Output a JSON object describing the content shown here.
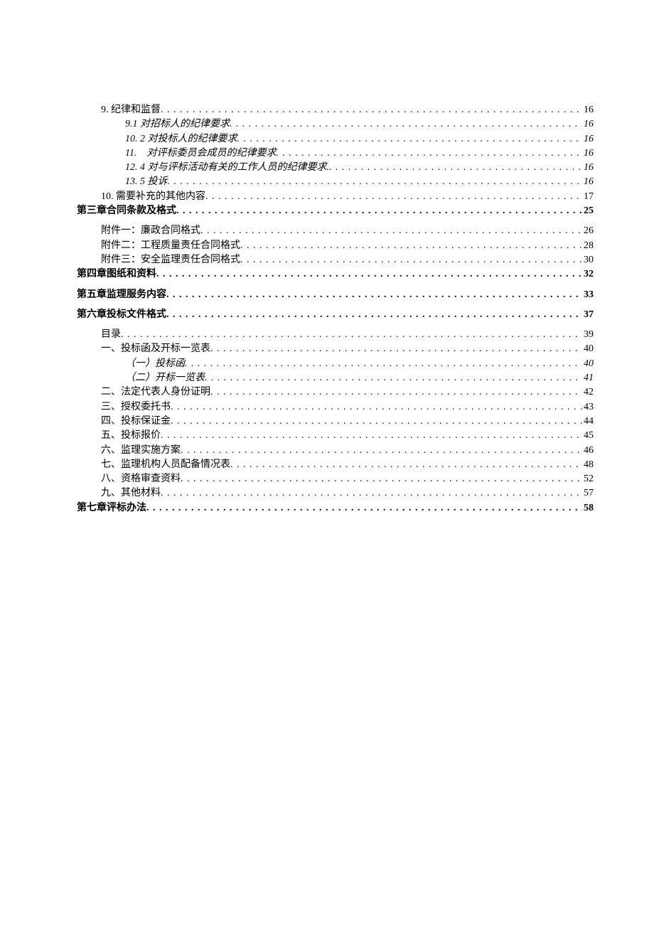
{
  "toc": [
    {
      "label": "9. 纪律和监督",
      "page": "16",
      "indent": 1,
      "italic": false,
      "bold": false,
      "gapBefore": false
    },
    {
      "label": "9.1 对招标人的纪律要求",
      "page": "16",
      "indent": 2,
      "italic": true,
      "bold": false,
      "gapBefore": false
    },
    {
      "label": "10. 2 对投标人的纪律要求",
      "page": "16",
      "indent": 2,
      "italic": true,
      "bold": false,
      "gapBefore": false
    },
    {
      "label": "11.　对评标委员会成员的纪律要求",
      "page": "16",
      "indent": 2,
      "italic": true,
      "bold": false,
      "gapBefore": false
    },
    {
      "label": "12. 4 对与评标活动有关的工作人员的纪律要求.",
      "page": "16",
      "indent": 2,
      "italic": true,
      "bold": false,
      "gapBefore": false
    },
    {
      "label": "13. 5 投诉",
      "page": "16",
      "indent": 2,
      "italic": true,
      "bold": false,
      "gapBefore": false
    },
    {
      "label": "10. 需要补充的其他内容",
      "page": "17",
      "indent": 1,
      "italic": false,
      "bold": false,
      "gapBefore": false
    },
    {
      "label": "第三章合同条款及格式",
      "page": "25",
      "indent": 0,
      "italic": false,
      "bold": true,
      "gapBefore": false
    },
    {
      "label": "附件一：廉政合同格式",
      "page": "26",
      "indent": 1,
      "italic": false,
      "bold": false,
      "gapBefore": true
    },
    {
      "label": "附件二：工程质量责任合同格式",
      "page": "28",
      "indent": 1,
      "italic": false,
      "bold": false,
      "gapBefore": false
    },
    {
      "label": "附件三：安全监理责任合同格式",
      "page": "30",
      "indent": 1,
      "italic": false,
      "bold": false,
      "gapBefore": false
    },
    {
      "label": "第四章图纸和资料",
      "page": "32",
      "indent": 0,
      "italic": false,
      "bold": true,
      "gapBefore": false
    },
    {
      "label": "第五章监理服务内容",
      "page": "33",
      "indent": 0,
      "italic": false,
      "bold": true,
      "gapBefore": true
    },
    {
      "label": "第六章投标文件格式",
      "page": "37",
      "indent": 0,
      "italic": false,
      "bold": true,
      "gapBefore": true
    },
    {
      "label": "目录",
      "page": "39",
      "indent": 1,
      "italic": false,
      "bold": false,
      "gapBefore": true
    },
    {
      "label": "一、投标函及开标一览表",
      "page": "40",
      "indent": 1,
      "italic": false,
      "bold": false,
      "gapBefore": false
    },
    {
      "label": "（一）投标函",
      "page": "40",
      "indent": 2,
      "italic": true,
      "bold": false,
      "gapBefore": false
    },
    {
      "label": "（二）开标一览表",
      "page": "41",
      "indent": 2,
      "italic": true,
      "bold": false,
      "gapBefore": false
    },
    {
      "label": "二、法定代表人身份证明",
      "page": "42",
      "indent": 1,
      "italic": false,
      "bold": false,
      "gapBefore": false
    },
    {
      "label": "三、授权委托书",
      "page": "43",
      "indent": 1,
      "italic": false,
      "bold": false,
      "gapBefore": false
    },
    {
      "label": "四、投标保证金",
      "page": "44",
      "indent": 1,
      "italic": false,
      "bold": false,
      "gapBefore": false
    },
    {
      "label": "五、投标报价",
      "page": "45",
      "indent": 1,
      "italic": false,
      "bold": false,
      "gapBefore": false
    },
    {
      "label": "六、监理实施方案",
      "page": "46",
      "indent": 1,
      "italic": false,
      "bold": false,
      "gapBefore": false
    },
    {
      "label": "七、监理机构人员配备情况表",
      "page": "48",
      "indent": 1,
      "italic": false,
      "bold": false,
      "gapBefore": false
    },
    {
      "label": "八、资格审查资料",
      "page": "52",
      "indent": 1,
      "italic": false,
      "bold": false,
      "gapBefore": false
    },
    {
      "label": "九、其他材料",
      "page": "57",
      "indent": 1,
      "italic": false,
      "bold": false,
      "gapBefore": false
    },
    {
      "label": "第七章评标办法",
      "page": "58",
      "indent": 0,
      "italic": false,
      "bold": true,
      "gapBefore": false
    }
  ]
}
